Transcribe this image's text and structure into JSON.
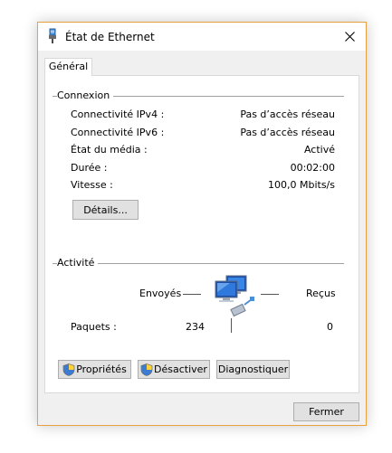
{
  "window": {
    "title": "État de Ethernet",
    "icon": "ethernet-connector-icon",
    "close_icon": "close-icon"
  },
  "tabs": [
    {
      "label": "Général",
      "selected": true
    }
  ],
  "connection": {
    "heading": "Connexion",
    "rows": [
      {
        "label": "Connectivité IPv4 :",
        "value": "Pas d’accès réseau"
      },
      {
        "label": "Connectivité IPv6 :",
        "value": "Pas d’accès réseau"
      },
      {
        "label": "État du média :",
        "value": "Activé"
      },
      {
        "label": "Durée :",
        "value": "00:02:00"
      },
      {
        "label": "Vitesse :",
        "value": "100,0 Mbits/s"
      }
    ],
    "details_button": "Détails..."
  },
  "activity": {
    "heading": "Activité",
    "sent_label": "Envoyés",
    "received_label": "Reçus",
    "packets_label": "Paquets :",
    "packets_sent": "234",
    "packets_received": "0",
    "network_icon": "network-computers-icon"
  },
  "buttons": {
    "properties": "Propriétés",
    "disable": "Désactiver",
    "diagnose": "Diagnostiquer",
    "close": "Fermer"
  },
  "colors": {
    "accent_border": "#e8a041",
    "button_face": "#e1e1e1",
    "dialog_bg": "#f0f0f0"
  }
}
